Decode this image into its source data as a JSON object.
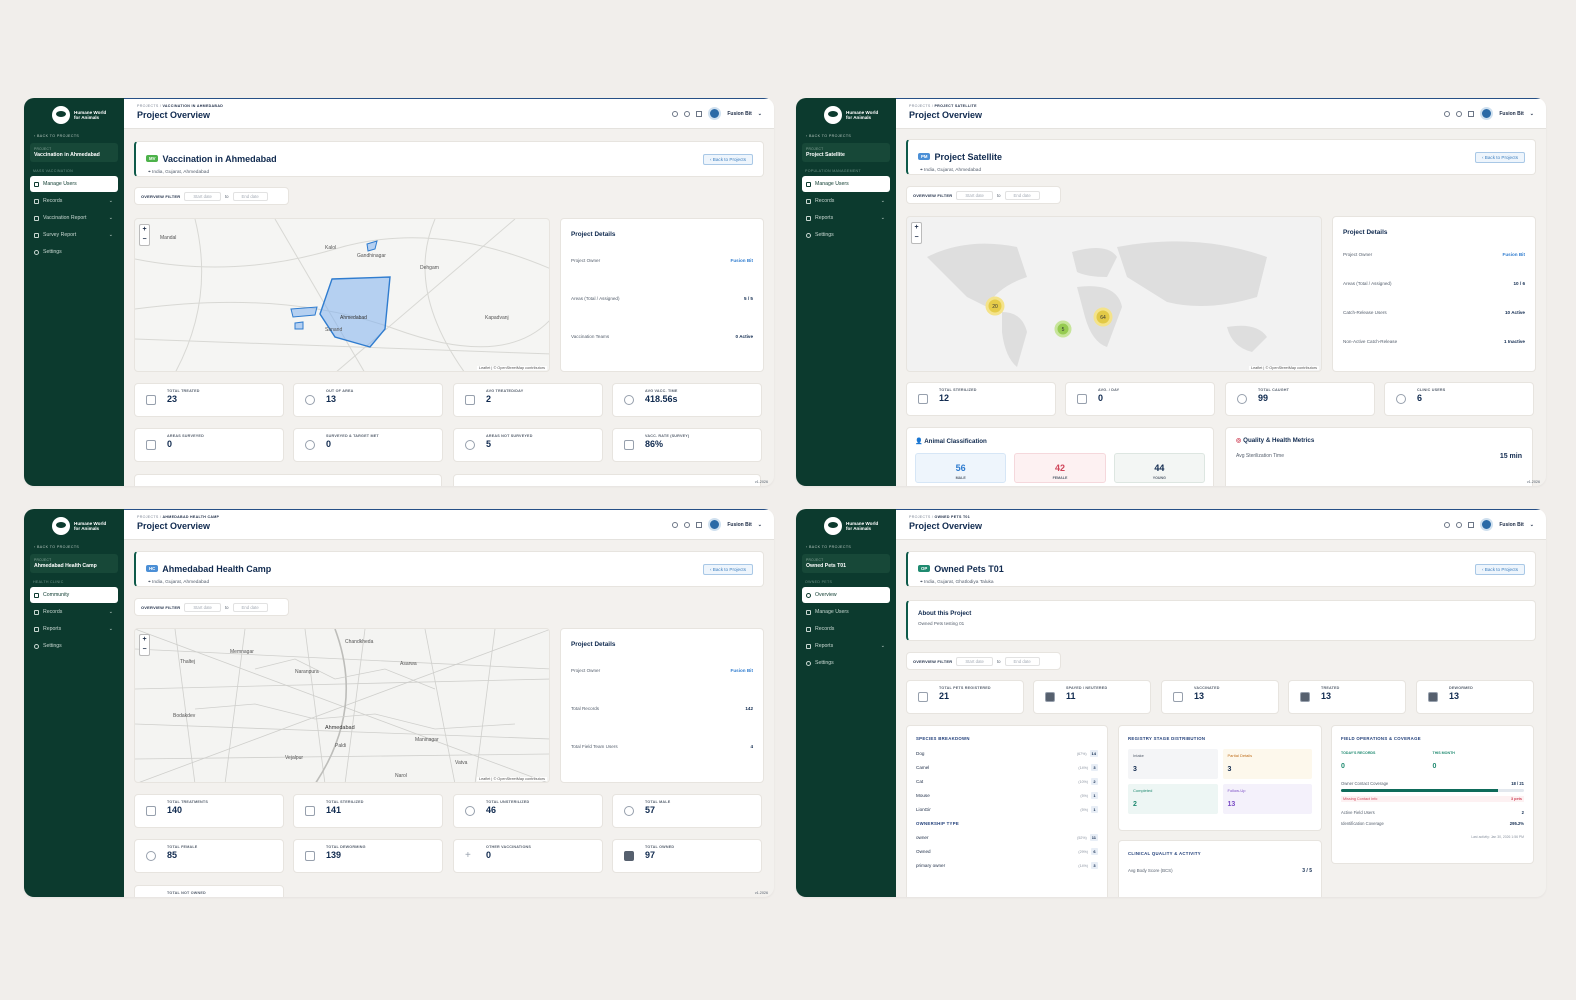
{
  "common": {
    "org_name": "Humane World for Animals",
    "back_to_projects": "BACK TO PROJECTS",
    "project_label": "PROJECT",
    "crumb_root": "PROJECTS",
    "page_title": "Project Overview",
    "user_name": "Fusion Bit",
    "back_button": "Back to Projects",
    "overview_filter": "OVERVIEW FILTER",
    "start_date": "Start date",
    "end_date": "End date",
    "to": "to",
    "details_title": "Project Details",
    "project_owner_label": "Project Owner",
    "version": "v1.2026",
    "map_attribution": "Leaflet | © OpenStreetMap contributors",
    "accent_green": "#0c3a2e",
    "accent_blue": "#2f7ccf"
  },
  "p1": {
    "crumb": "VACCINATION IN AHMEDABAD",
    "project_name": "Vaccination in Ahmedabad",
    "section": "MASS VACCINATION",
    "nav": [
      "Manage Users",
      "Records",
      "Vaccination Report",
      "Survey Report",
      "Settings"
    ],
    "badge": "MV",
    "location": "India, Gujarat, Ahmedabad",
    "map_labels": [
      "Kalol",
      "Gandhinagar",
      "Ahmedabad",
      "Sanand",
      "Mandal",
      "Dehgam",
      "Kapadvanj"
    ],
    "details": [
      {
        "label": "Project Owner",
        "value": "Fusion Bit"
      },
      {
        "label": "Areas (Total / Assigned)",
        "value": "5 / 5"
      },
      {
        "label": "Vaccination Teams",
        "value": "0 Active"
      }
    ],
    "stats": [
      {
        "label": "TOTAL TREATED",
        "value": "23"
      },
      {
        "label": "OUT OF AREA",
        "value": "13"
      },
      {
        "label": "AVG TREATED/DAY",
        "value": "2"
      },
      {
        "label": "AVG VACC. TIME",
        "value": "418.56s"
      },
      {
        "label": "AREAS SURVEYED",
        "value": "0"
      },
      {
        "label": "SURVEYED & TARGET MET",
        "value": "0"
      },
      {
        "label": "AREAS NOT SURVEYED",
        "value": "5"
      },
      {
        "label": "VACC. RATE (SURVEY)",
        "value": "86%"
      }
    ]
  },
  "p2": {
    "crumb": "PROJECT SATELLITE",
    "project_name": "Project Satellite",
    "section": "POPULATION MANAGEMENT",
    "nav": [
      "Manage Users",
      "Records",
      "Reports",
      "Settings"
    ],
    "badge": "PM",
    "location": "India, Gujarat, Ahmedabad",
    "clusters": [
      "20",
      "5",
      "64"
    ],
    "details": [
      {
        "label": "Project Owner",
        "value": "Fusion Bit"
      },
      {
        "label": "Areas (Total / Assigned)",
        "value": "10 / 6"
      },
      {
        "label": "Catch-Release Users",
        "value": "10 Active"
      },
      {
        "label": "Non-Active Catch-Release",
        "value": "1 Inactive"
      }
    ],
    "stats": [
      {
        "label": "TOTAL STERILIZED",
        "value": "12"
      },
      {
        "label": "AVG. / DAY",
        "value": "0"
      },
      {
        "label": "TOTAL CAUGHT",
        "value": "99"
      },
      {
        "label": "CLINIC USERS",
        "value": "6"
      }
    ],
    "animal_title": "Animal Classification",
    "animals": [
      {
        "label": "MALE",
        "value": "56",
        "color": "#2f7ccf"
      },
      {
        "label": "FEMALE",
        "value": "42",
        "color": "#d0455a"
      },
      {
        "label": "YOUNG",
        "value": "44",
        "color": "#102a4f"
      }
    ],
    "quality_title": "Quality & Health Metrics",
    "quality_label": "Avg Sterilization Time",
    "quality_value": "15 min"
  },
  "p3": {
    "crumb": "AHMEDABAD HEALTH CAMP",
    "project_name": "Ahmedabad Health Camp",
    "section": "HEALTH CLINIC",
    "nav": [
      "Community",
      "Records",
      "Reports",
      "Settings"
    ],
    "badge": "HC",
    "location": "India, Gujarat, Ahmedabad",
    "map_labels": [
      "Chandkheda",
      "Memnagar",
      "Asarwa",
      "Thaltej",
      "Naranpura",
      "Bodakdev",
      "Ahmedabad",
      "Vejalpur",
      "Maninagar",
      "Vatva",
      "Narol",
      "Paldi"
    ],
    "details": [
      {
        "label": "Project Owner",
        "value": "Fusion Bit"
      },
      {
        "label": "Total Records",
        "value": "142"
      },
      {
        "label": "Total Field Team Users",
        "value": "4"
      }
    ],
    "stats": [
      {
        "label": "TOTAL TREATMENTS",
        "value": "140"
      },
      {
        "label": "TOTAL STERILIZED",
        "value": "141"
      },
      {
        "label": "TOTAL UNSTERILIZED",
        "value": "46"
      },
      {
        "label": "TOTAL MALE",
        "value": "57"
      },
      {
        "label": "TOTAL FEMALE",
        "value": "85"
      },
      {
        "label": "TOTAL DEWORMING",
        "value": "139"
      },
      {
        "label": "OTHER VACCINATIONS",
        "value": "0"
      },
      {
        "label": "TOTAL OWNED",
        "value": "97"
      }
    ],
    "extra_stat": "TOTAL NOT OWNED"
  },
  "p4": {
    "crumb": "OWNED PETS T01",
    "project_name": "Owned Pets T01",
    "section": "OWNED PETS",
    "nav": [
      "Overview",
      "Manage Users",
      "Records",
      "Reports",
      "Settings"
    ],
    "badge": "OP",
    "location": "India, Gujarat, Ghatlodiya Taluka",
    "about_title": "About this Project",
    "about_text": "Owned Pets testing 01",
    "stats": [
      {
        "label": "TOTAL PETS REGISTERED",
        "value": "21"
      },
      {
        "label": "SPAYED / NEUTERED",
        "value": "11"
      },
      {
        "label": "VACCINATED",
        "value": "13"
      },
      {
        "label": "TREATED",
        "value": "13"
      },
      {
        "label": "DEWORMED",
        "value": "13"
      }
    ],
    "species_title": "SPECIES BREAKDOWN",
    "species": [
      {
        "name": "Dog",
        "pct": "(67%)",
        "count": "14"
      },
      {
        "name": "Camel",
        "pct": "(14%)",
        "count": "3"
      },
      {
        "name": "Cat",
        "pct": "(10%)",
        "count": "2"
      },
      {
        "name": "Mouse",
        "pct": "(5%)",
        "count": "1"
      },
      {
        "name": "LionGir",
        "pct": "(5%)",
        "count": "1"
      }
    ],
    "ownership_title": "OWNERSHIP TYPE",
    "ownership": [
      {
        "name": "owner",
        "pct": "(52%)",
        "count": "11"
      },
      {
        "name": "Owned",
        "pct": "(29%)",
        "count": "6"
      },
      {
        "name": "primary owner",
        "pct": "(14%)",
        "count": "3"
      }
    ],
    "registry_title": "REGISTRY STAGE DISTRIBUTION",
    "registry": [
      {
        "label": "Intake",
        "value": "3",
        "bg": "#f4f5f7",
        "fg": "#56606e"
      },
      {
        "label": "Partial Details",
        "value": "3",
        "bg": "#fdf8ec",
        "fg": "#c0701e"
      },
      {
        "label": "Completed",
        "value": "2",
        "bg": "#edf6f4",
        "fg": "#1f8a70"
      },
      {
        "label": "Follow-Up",
        "value": "13",
        "bg": "#f4f1fb",
        "fg": "#7a4cc4"
      }
    ],
    "clinical_title": "CLINICAL QUALITY & ACTIVITY",
    "clinical_label": "Avg Body Score (BCS)",
    "clinical_value": "3 / 5",
    "field_title": "FIELD OPERATIONS & COVERAGE",
    "today_label": "TODAY'S RECORDS",
    "today_value": "0",
    "month_label": "THIS MONTH",
    "month_value": "0",
    "coverage_label": "Owner Contact Coverage",
    "coverage_value": "18 / 21",
    "coverage_fraction": 0.86,
    "missing_label": "Missing Contact Info",
    "missing_value": "3 pets",
    "active_label": "Active Field Users",
    "active_value": "2",
    "ident_label": "Identification Coverage",
    "ident_value": "295.2%",
    "last_activity": "Last activity: Jan 30, 2026 1:56 PM"
  }
}
